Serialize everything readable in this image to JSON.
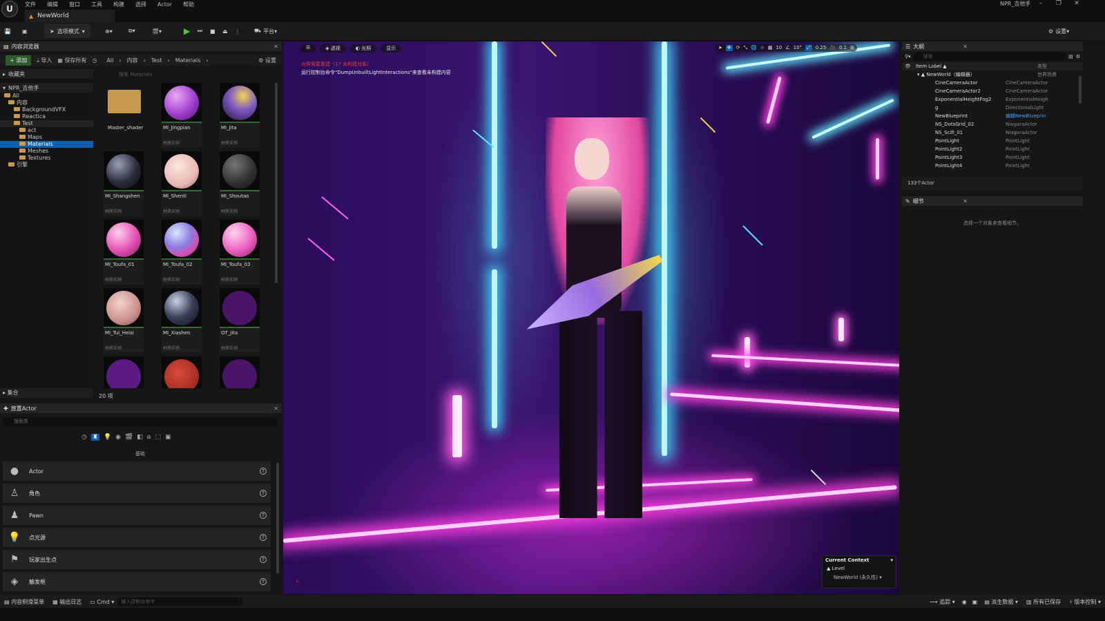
{
  "app": {
    "logo": "U",
    "project_name": "NPR_吉他手",
    "document_tab": "NewWorld",
    "menu": [
      "文件",
      "编辑",
      "窗口",
      "工具",
      "构建",
      "选择",
      "Actor",
      "帮助"
    ]
  },
  "toolbar": {
    "mode": "选项模式",
    "platform": "平台",
    "settings": "设置"
  },
  "content_browser": {
    "tab": "内容浏览器",
    "add": "+ 添加",
    "import": "导入",
    "save_all": "保存所有",
    "crumbs": [
      "All",
      "内容",
      "Test",
      "Materials"
    ],
    "settings": "设置",
    "search_placeholder": "搜索 Materials",
    "favorites": "收藏夹",
    "root": "NPR_吉他手",
    "tree": [
      "All",
      "内容",
      "BackgroundVFX",
      "Reactica",
      "Test",
      "act",
      "Maps",
      "Materials",
      "Meshes",
      "Textures",
      "引擎"
    ],
    "collections": "集合",
    "count": "20 项",
    "assets": [
      {
        "name": "Master_shader",
        "type": ""
      },
      {
        "name": "MI_Jingpian",
        "type": "材质实例"
      },
      {
        "name": "MI_Jita",
        "type": "材质实例"
      },
      {
        "name": "MI_Shangshen",
        "type": "材质实例"
      },
      {
        "name": "MI_Shenti",
        "type": "材质实例"
      },
      {
        "name": "MI_Shoutao",
        "type": "材质实例"
      },
      {
        "name": "MI_Toufa_01",
        "type": "材质实例"
      },
      {
        "name": "MI_Toufa_02",
        "type": "材质实例"
      },
      {
        "name": "MI_Toufa_03",
        "type": "材质实例"
      },
      {
        "name": "MI_Tui_Heisi",
        "type": "材质实例"
      },
      {
        "name": "MI_Xiashen",
        "type": "材质实例"
      },
      {
        "name": "OT_Jita",
        "type": "材质实例"
      }
    ]
  },
  "place_actor": {
    "tab": "放置Actor",
    "search_placeholder": "搜索类",
    "category": "基础",
    "items": [
      "Actor",
      "角色",
      "Pawn",
      "点光源",
      "玩家出生点",
      "触发框"
    ]
  },
  "viewport": {
    "view_mode": "透视",
    "lighting": "光照",
    "show": "显示",
    "warning": "光照需要重建（17 未构建对象）",
    "info": "运行控制台命令\"DumpUnbuiltLightInteractions\"来查看未构建内容",
    "grid_snap": "10",
    "rot_snap": "10°",
    "scale_snap": "0.25",
    "cam_speed": "0.1",
    "context_title": "Current Context",
    "context_level": "Level",
    "context_world": "NewWorld (永久性)"
  },
  "outliner": {
    "tab": "大纲",
    "search_placeholder": "搜索",
    "col_label": "Item Label ▲",
    "col_type": "类型",
    "root": {
      "name": "NewWorld（编辑器）",
      "type": "世界场景"
    },
    "rows": [
      {
        "name": "CineCameraActor",
        "type": "CineCameraActor"
      },
      {
        "name": "CineCameraActor2",
        "type": "CineCameraActor"
      },
      {
        "name": "ExponentialHeightFog2",
        "type": "ExponentialHeigh"
      },
      {
        "name": "g",
        "type": "DirectionalLight"
      },
      {
        "name": "NewBlueprint",
        "type": "编辑NewBlueprin"
      },
      {
        "name": "NS_DotsGrid_02",
        "type": "NiagaraActor"
      },
      {
        "name": "NS_Scifi_01",
        "type": "NiagaraActor"
      },
      {
        "name": "PointLight",
        "type": "PointLight"
      },
      {
        "name": "PointLight2",
        "type": "PointLight"
      },
      {
        "name": "PointLight3",
        "type": "PointLight"
      },
      {
        "name": "PointLight4",
        "type": "PointLight"
      }
    ],
    "count": "133个Actor"
  },
  "details": {
    "tab": "细节",
    "hint": "选择一个对象来查看细节。"
  },
  "status": {
    "content_drawer": "内容侧滑菜单",
    "output_log": "输出日志",
    "cmd": "Cmd",
    "console_placeholder": "输入控制台命令",
    "trace": "追踪",
    "derived_data": "派生数据",
    "all_saved": "所有已保存",
    "source_control": "版本控制"
  },
  "colors": {
    "accent": "#0f5fb0",
    "play": "#5fbf3f",
    "warning": "#e8393a",
    "neon_pink": "#ff3fe0",
    "neon_cyan": "#5fe9ff"
  }
}
